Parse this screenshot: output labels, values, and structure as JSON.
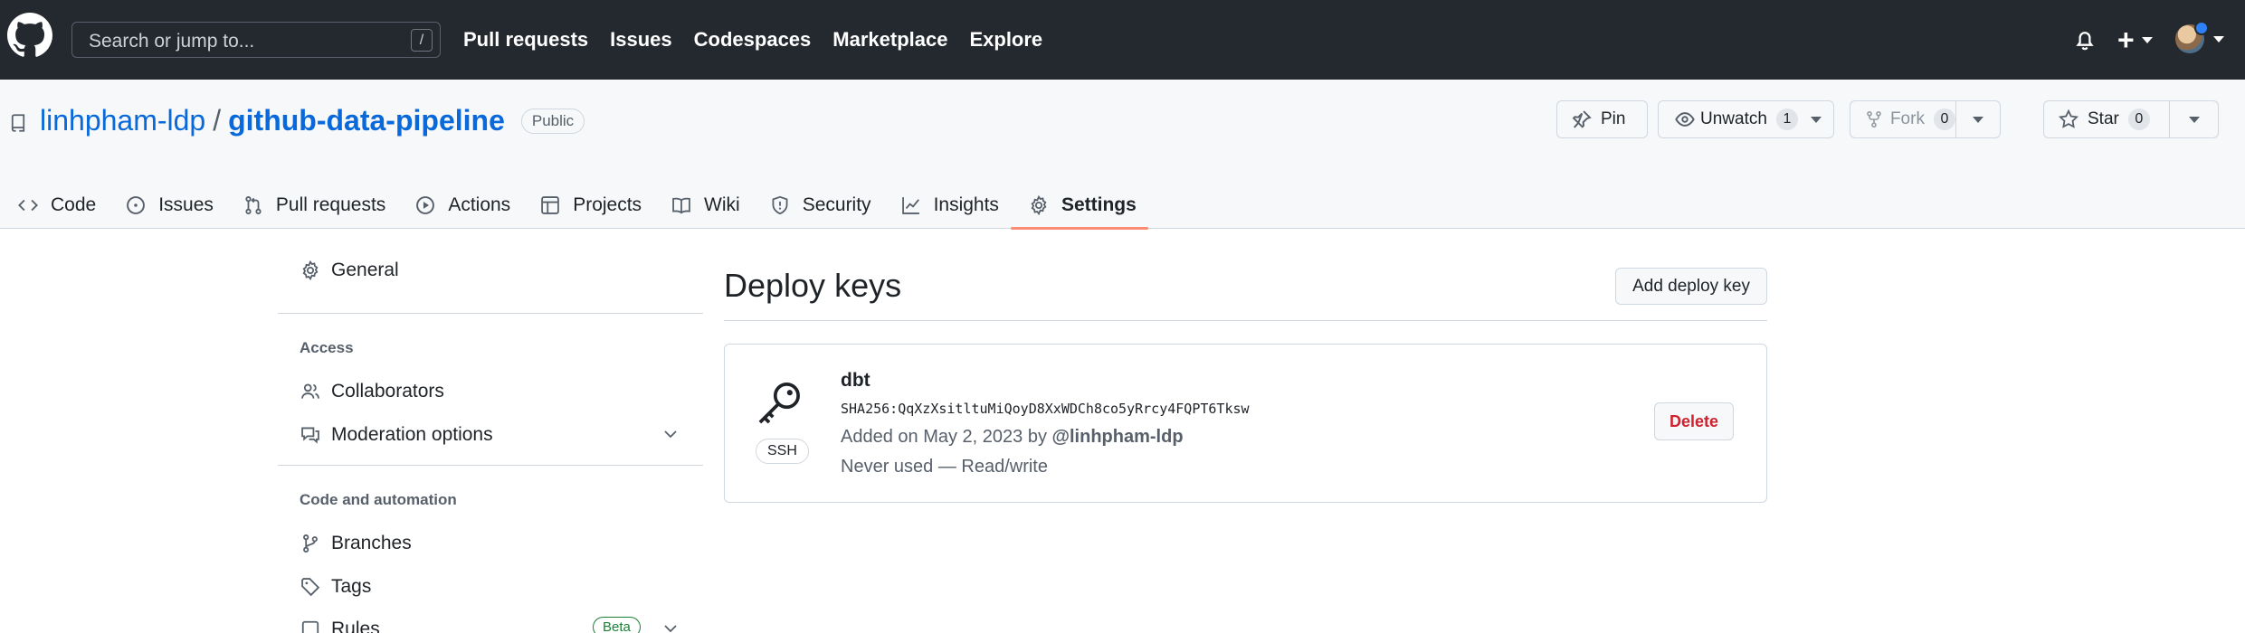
{
  "header": {
    "search_placeholder": "Search or jump to...",
    "search_shortcut": "/",
    "nav": [
      "Pull requests",
      "Issues",
      "Codespaces",
      "Marketplace",
      "Explore"
    ],
    "create_label": "+"
  },
  "repo": {
    "owner": "linhpham-ldp",
    "separator": "/",
    "name": "github-data-pipeline",
    "visibility": "Public",
    "pin_label": "Pin",
    "watch_label": "Unwatch",
    "watch_count": "1",
    "fork_label": "Fork",
    "fork_count": "0",
    "star_label": "Star",
    "star_count": "0",
    "tabs": [
      "Code",
      "Issues",
      "Pull requests",
      "Actions",
      "Projects",
      "Wiki",
      "Security",
      "Insights",
      "Settings"
    ],
    "active_tab": "Settings"
  },
  "sidebar": {
    "general": "General",
    "access_heading": "Access",
    "collaborators": "Collaborators",
    "moderation": "Moderation options",
    "code_heading": "Code and automation",
    "branches": "Branches",
    "tags": "Tags",
    "rules": "Rules",
    "rules_badge": "Beta"
  },
  "main": {
    "title": "Deploy keys",
    "add_button": "Add deploy key",
    "key": {
      "type": "SSH",
      "name": "dbt",
      "fingerprint": "SHA256:QqXzXsitltuMiQoyD8XxWDCh8co5yRrcy4FQPT6Tksw",
      "added_prefix": "Added on May 2, 2023 by ",
      "added_by": "@linhpham-ldp",
      "usage": "Never used — Read/write",
      "delete_label": "Delete"
    }
  },
  "colors": {
    "header_bg": "#24292f",
    "link": "#0969da",
    "active_tab_underline": "#fd8c73",
    "danger": "#cf222e",
    "beta_green": "#1a7f37"
  }
}
